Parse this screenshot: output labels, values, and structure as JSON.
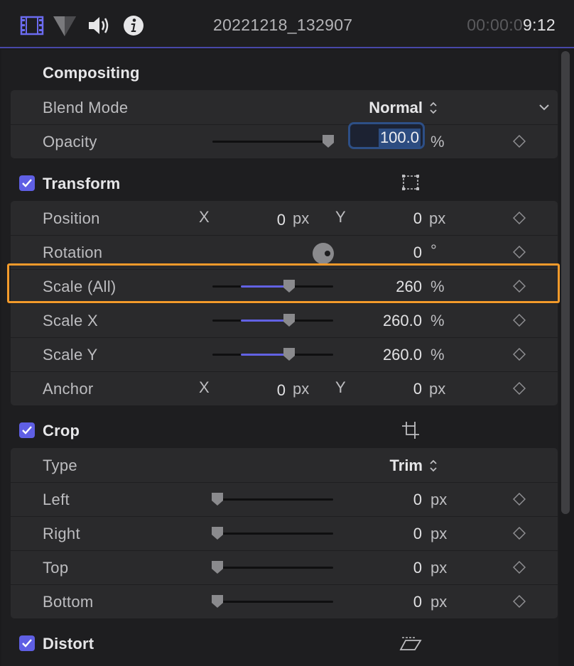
{
  "header": {
    "icons": [
      "video-inspector-icon",
      "color-inspector-icon",
      "audio-inspector-icon",
      "info-inspector-icon"
    ],
    "clip_name": "20221218_132907",
    "timecode_dim": "00:00:0",
    "timecode_lit": "9:12"
  },
  "compositing": {
    "title": "Compositing",
    "blend_mode": {
      "label": "Blend Mode",
      "value": "Normal"
    },
    "opacity": {
      "label": "Opacity",
      "value": "100.0",
      "unit": "%",
      "slider_fraction": 1.0
    }
  },
  "transform": {
    "title": "Transform",
    "enabled": true,
    "position": {
      "label": "Position",
      "x_label": "X",
      "x_value": "0",
      "y_label": "Y",
      "y_value": "0",
      "unit": "px"
    },
    "rotation": {
      "label": "Rotation",
      "value": "0",
      "unit": "°"
    },
    "scale_all": {
      "label": "Scale (All)",
      "value": "260",
      "unit": "%",
      "slider_fraction": 0.63
    },
    "scale_x": {
      "label": "Scale X",
      "value": "260.0",
      "unit": "%",
      "slider_fraction": 0.63
    },
    "scale_y": {
      "label": "Scale Y",
      "value": "260.0",
      "unit": "%",
      "slider_fraction": 0.63
    },
    "anchor": {
      "label": "Anchor",
      "x_label": "X",
      "x_value": "0",
      "y_label": "Y",
      "y_value": "0",
      "unit": "px"
    }
  },
  "crop": {
    "title": "Crop",
    "enabled": true,
    "type": {
      "label": "Type",
      "value": "Trim"
    },
    "left": {
      "label": "Left",
      "value": "0",
      "unit": "px",
      "slider_fraction": 0
    },
    "right": {
      "label": "Right",
      "value": "0",
      "unit": "px",
      "slider_fraction": 0
    },
    "top": {
      "label": "Top",
      "value": "0",
      "unit": "px",
      "slider_fraction": 0
    },
    "bottom": {
      "label": "Bottom",
      "value": "0",
      "unit": "px",
      "slider_fraction": 0
    }
  },
  "distort": {
    "title": "Distort",
    "enabled": true
  },
  "colors": {
    "accent": "#5f5fe4",
    "highlight": "#f29a2b",
    "slider_fill": "#6262e4"
  }
}
